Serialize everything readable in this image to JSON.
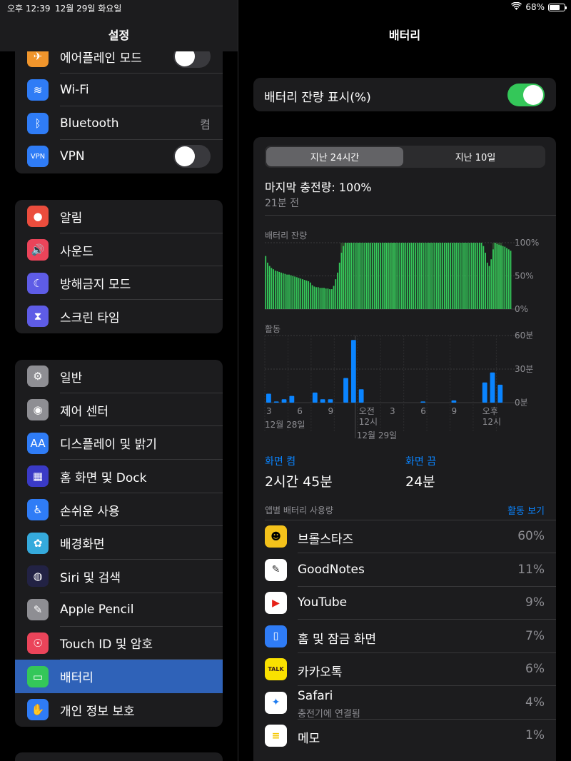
{
  "status_bar": {
    "time": "오후 12:39",
    "date": "12월 29일 화요일",
    "battery_pct": "68%",
    "battery_level": 0.68
  },
  "sidebar": {
    "title": "설정",
    "group1": [
      {
        "label": "에어플레인 모드",
        "icon": "airplane-icon",
        "glyph": "✈",
        "color": "#f0952c",
        "control": "toggle",
        "on": false
      },
      {
        "label": "Wi-Fi",
        "icon": "wifi-icon",
        "glyph": "≋",
        "color": "#2f7cf6",
        "control": "none"
      },
      {
        "label": "Bluetooth",
        "icon": "bluetooth-icon",
        "glyph": "ᛒ",
        "color": "#2f7cf6",
        "control": "value",
        "value": "켬"
      },
      {
        "label": "VPN",
        "icon": "vpn-icon",
        "glyph": "VPN",
        "color": "#2f7cf6",
        "control": "toggle",
        "on": false
      }
    ],
    "group2": [
      {
        "label": "알림",
        "icon": "notifications-icon",
        "glyph": "●",
        "color": "#eb4d3d"
      },
      {
        "label": "사운드",
        "icon": "sound-icon",
        "glyph": "🔊",
        "color": "#eb445a"
      },
      {
        "label": "방해금지 모드",
        "icon": "moon-icon",
        "glyph": "☾",
        "color": "#5e5ce6"
      },
      {
        "label": "스크린 타임",
        "icon": "hourglass-icon",
        "glyph": "⧗",
        "color": "#5e5ce6"
      }
    ],
    "group3": [
      {
        "label": "일반",
        "icon": "gear-icon",
        "glyph": "⚙",
        "color": "#8e8e93"
      },
      {
        "label": "제어 센터",
        "icon": "control-center-icon",
        "glyph": "◉",
        "color": "#8e8e93"
      },
      {
        "label": "디스플레이 및 밝기",
        "icon": "display-icon",
        "glyph": "AA",
        "color": "#2f7cf6"
      },
      {
        "label": "홈 화면 및 Dock",
        "icon": "home-screen-icon",
        "glyph": "▦",
        "color": "#3a3ac6"
      },
      {
        "label": "손쉬운 사용",
        "icon": "accessibility-icon",
        "glyph": "♿",
        "color": "#2f7cf6"
      },
      {
        "label": "배경화면",
        "icon": "wallpaper-icon",
        "glyph": "✿",
        "color": "#35aadc"
      },
      {
        "label": "Siri 및 검색",
        "icon": "siri-icon",
        "glyph": "◍",
        "color": "#222244"
      },
      {
        "label": "Apple Pencil",
        "icon": "pencil-icon",
        "glyph": "✎",
        "color": "#8e8e93"
      },
      {
        "label": "Touch ID 및 암호",
        "icon": "fingerprint-icon",
        "glyph": "☉",
        "color": "#eb445a"
      },
      {
        "label": "배터리",
        "icon": "battery-icon",
        "glyph": "▭",
        "color": "#34c759",
        "selected": true
      },
      {
        "label": "개인 정보 보호",
        "icon": "hand-icon",
        "glyph": "✋",
        "color": "#2f7cf6"
      }
    ]
  },
  "detail": {
    "title": "배터리",
    "battery_percentage_label": "배터리 잔량 표시(%)",
    "battery_percentage_on": true,
    "segments": {
      "active": "지난 24시간",
      "inactive": "지난 10일"
    },
    "last_charge": "마지막 충전량: 100%",
    "last_charge_time": "21분 전",
    "battery_chart_label": "배터리 잔량",
    "activity_chart_label": "활동",
    "screen_on": {
      "label": "화면 켬",
      "value": "2시간 45분"
    },
    "screen_off": {
      "label": "화면 끔",
      "value": "24분"
    },
    "app_usage_header": "앱별 배터리 사용량",
    "app_usage_link": "활동 보기",
    "apps": [
      {
        "name": "브롤스타즈",
        "pct": "60%",
        "icon": "brawl-stars-icon",
        "glyph": "☻",
        "bg": "#f4c21b",
        "fg": "#000"
      },
      {
        "name": "GoodNotes",
        "pct": "11%",
        "icon": "goodnotes-icon",
        "glyph": "✎",
        "bg": "#ffffff",
        "fg": "#333"
      },
      {
        "name": "YouTube",
        "pct": "9%",
        "icon": "youtube-icon",
        "glyph": "▶",
        "bg": "#ffffff",
        "fg": "#e62117"
      },
      {
        "name": "홈 및 잠금 화면",
        "pct": "7%",
        "icon": "home-lock-icon",
        "glyph": "▯",
        "bg": "#2f7cf6",
        "fg": "#fff"
      },
      {
        "name": "카카오톡",
        "pct": "6%",
        "icon": "kakaotalk-icon",
        "glyph": "TALK",
        "bg": "#fae100",
        "fg": "#3b1e1e"
      },
      {
        "name": "Safari",
        "sub": "충전기에 연결됨",
        "pct": "4%",
        "icon": "safari-icon",
        "glyph": "✦",
        "bg": "#ffffff",
        "fg": "#1e7cf0"
      },
      {
        "name": "메모",
        "pct": "1%",
        "icon": "notes-icon",
        "glyph": "≡",
        "bg": "#ffffff",
        "fg": "#f6c700"
      }
    ]
  },
  "chart_data": [
    {
      "type": "bar",
      "title": "배터리 잔량",
      "y_ticks": [
        "100%",
        "50%",
        "0%"
      ],
      "ylim": [
        0,
        100
      ],
      "colors": {
        "bar": "#34c759",
        "low": "#ff453a",
        "charging_band": "#2d4a2d"
      },
      "values": [
        80,
        70,
        65,
        62,
        60,
        58,
        57,
        56,
        55,
        54,
        53,
        52,
        52,
        51,
        50,
        49,
        48,
        47,
        46,
        45,
        44,
        43,
        42,
        40,
        36,
        34,
        33,
        33,
        32,
        32,
        32,
        31,
        31,
        30,
        30,
        35,
        45,
        55,
        70,
        85,
        95,
        100,
        100,
        100,
        100,
        100,
        100,
        100,
        100,
        100,
        100,
        100,
        100,
        100,
        100,
        100,
        100,
        100,
        100,
        100,
        100,
        100,
        100,
        100,
        100,
        100,
        100,
        100,
        100,
        100,
        100,
        100,
        100,
        100,
        100,
        100,
        100,
        100,
        100,
        100,
        100,
        100,
        100,
        100,
        100,
        100,
        100,
        100,
        100,
        100,
        100,
        100,
        100,
        100,
        100,
        100,
        100,
        100,
        100,
        100,
        100,
        100,
        100,
        100,
        100,
        100,
        100,
        100,
        100,
        100,
        100,
        100,
        95,
        85,
        70,
        65,
        75,
        90,
        100,
        98,
        97,
        96,
        95,
        94,
        92,
        90,
        88
      ],
      "charging_ranges": [
        [
          39,
          43
        ],
        [
          62,
          67
        ],
        [
          117,
          122
        ]
      ]
    },
    {
      "type": "bar",
      "title": "활동",
      "y_ticks": [
        "60분",
        "30분",
        "0분"
      ],
      "ylim": [
        0,
        60
      ],
      "x_ticks": [
        "3",
        "6",
        "9",
        "오전\n12시",
        "3",
        "6",
        "9",
        "오후\n12시"
      ],
      "x_sublabels": [
        "12월 28일",
        "12월 29일"
      ],
      "colors": {
        "screen_on": "#0a84ff",
        "screen_off": "#5e9fe6"
      },
      "values": [
        8,
        1,
        3,
        6,
        0,
        0,
        9,
        3,
        3,
        0,
        22,
        56,
        12,
        0,
        0,
        0,
        0,
        0,
        0,
        0,
        1,
        0,
        0,
        0,
        2,
        0,
        0,
        0,
        18,
        27,
        16,
        0
      ]
    }
  ]
}
